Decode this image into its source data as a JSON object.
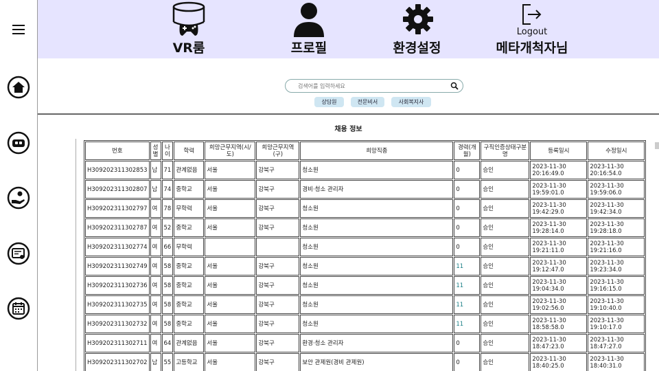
{
  "nav": {
    "vr_label": "VR룸",
    "profile_label": "프로필",
    "settings_label": "환경설정",
    "logout_text": "Logout",
    "user_label": "메타개척자님"
  },
  "search": {
    "placeholder": "검색어를 입력하세요"
  },
  "chips": [
    "상담원",
    "전문비서",
    "사회복지사"
  ],
  "section_title": "채용 정보",
  "table": {
    "headers": [
      "번호",
      "성별",
      "나이",
      "학력",
      "희망근무지역(시/도)",
      "희망근무지역(구)",
      "희망직종",
      "경력(개월)",
      "구직인증상태구분명",
      "등록일시",
      "수정일시"
    ],
    "rows": [
      [
        "H309202311302853",
        "남",
        "71",
        "관계없음",
        "서울",
        "강북구",
        "청소원",
        "0",
        "승인",
        "2023-11-30 20:16:49.0",
        "2023-11-30 20:16:54.0"
      ],
      [
        "H309202311302807",
        "남",
        "74",
        "중학교",
        "서울",
        "강북구",
        "경비·청소 관리자",
        "0",
        "승인",
        "2023-11-30 19:59:01.0",
        "2023-11-30 19:59:06.0"
      ],
      [
        "H309202311302797",
        "여",
        "78",
        "무학력",
        "서울",
        "강북구",
        "청소원",
        "0",
        "승인",
        "2023-11-30 19:42:29.0",
        "2023-11-30 19:42:34.0"
      ],
      [
        "H309202311302787",
        "여",
        "52",
        "중학교",
        "서울",
        "강북구",
        "청소원",
        "0",
        "승인",
        "2023-11-30 19:28:14.0",
        "2023-11-30 19:28:18.0"
      ],
      [
        "H309202311302774",
        "여",
        "66",
        "무학력",
        "",
        "",
        "청소원",
        "0",
        "승인",
        "2023-11-30 19:21:11.0",
        "2023-11-30 19:21:16.0"
      ],
      [
        "H309202311302749",
        "여",
        "58",
        "중학교",
        "서울",
        "강북구",
        "청소원",
        "11",
        "승인",
        "2023-11-30 19:12:47.0",
        "2023-11-30 19:23:34.0"
      ],
      [
        "H309202311302736",
        "여",
        "58",
        "중학교",
        "서울",
        "강북구",
        "청소원",
        "11",
        "승인",
        "2023-11-30 19:04:34.0",
        "2023-11-30 19:16:15.0"
      ],
      [
        "H309202311302735",
        "여",
        "58",
        "중학교",
        "서울",
        "강북구",
        "청소원",
        "11",
        "승인",
        "2023-11-30 19:02:56.0",
        "2023-11-30 19:10:40.0"
      ],
      [
        "H309202311302732",
        "여",
        "58",
        "중학교",
        "서울",
        "강북구",
        "청소원",
        "11",
        "승인",
        "2023-11-30 18:58:58.0",
        "2023-11-30 19:10:17.0"
      ],
      [
        "H309202311302711",
        "여",
        "64",
        "관계없음",
        "서울",
        "강북구",
        "환경·청소 관리자",
        "0",
        "승인",
        "2023-11-30 18:47:23.0",
        "2023-11-30 18:47:27.0"
      ],
      [
        "H309202311302702",
        "남",
        "55",
        "고등학교",
        "서울",
        "강북구",
        "보안 관제원(경비 관제원)",
        "0",
        "승인",
        "2023-11-30 18:40:25.0",
        "2023-11-30 18:40:31.0"
      ]
    ]
  },
  "colors": {
    "header_bg": "#e6e4ff",
    "chip_bg": "#cfe6f2",
    "career_text": "#1a7f86"
  },
  "icons": [
    "menu-icon",
    "home-icon",
    "vr-headset-icon",
    "hand-coin-icon",
    "document-search-icon",
    "calendar-icon",
    "search-icon",
    "logout-icon",
    "gear-icon",
    "person-icon"
  ]
}
